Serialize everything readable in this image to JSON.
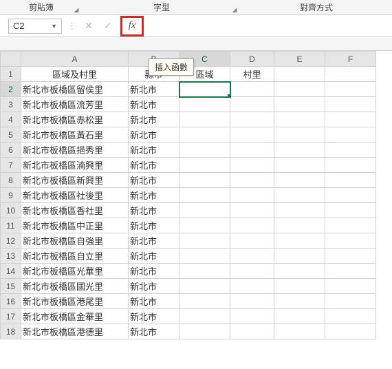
{
  "ribbon": {
    "group1": "剪貼簿",
    "group2": "字型",
    "group3": "對齊方式"
  },
  "namebox": "C2",
  "fx_label": "fx",
  "tooltip": "插入函數",
  "columns": [
    "A",
    "B",
    "C",
    "D",
    "E",
    "F"
  ],
  "headers": {
    "A": "區域及村里",
    "B": "縣市",
    "C": "區域",
    "D": "村里"
  },
  "rows": [
    {
      "a": "新北市板橋區留侯里",
      "b": "新北市"
    },
    {
      "a": "新北市板橋區流芳里",
      "b": "新北市"
    },
    {
      "a": "新北市板橋區赤松里",
      "b": "新北市"
    },
    {
      "a": "新北市板橋區黃石里",
      "b": "新北市"
    },
    {
      "a": "新北市板橋區挹秀里",
      "b": "新北市"
    },
    {
      "a": "新北市板橋區湳興里",
      "b": "新北市"
    },
    {
      "a": "新北市板橋區新興里",
      "b": "新北市"
    },
    {
      "a": "新北市板橋區社後里",
      "b": "新北市"
    },
    {
      "a": "新北市板橋區香社里",
      "b": "新北市"
    },
    {
      "a": "新北市板橋區中正里",
      "b": "新北市"
    },
    {
      "a": "新北市板橋區自強里",
      "b": "新北市"
    },
    {
      "a": "新北市板橋區自立里",
      "b": "新北市"
    },
    {
      "a": "新北市板橋區光華里",
      "b": "新北市"
    },
    {
      "a": "新北市板橋區國光里",
      "b": "新北市"
    },
    {
      "a": "新北市板橋區港尾里",
      "b": "新北市"
    },
    {
      "a": "新北市板橋區金華里",
      "b": "新北市"
    },
    {
      "a": "新北市板橋區港德里",
      "b": "新北市"
    }
  ]
}
